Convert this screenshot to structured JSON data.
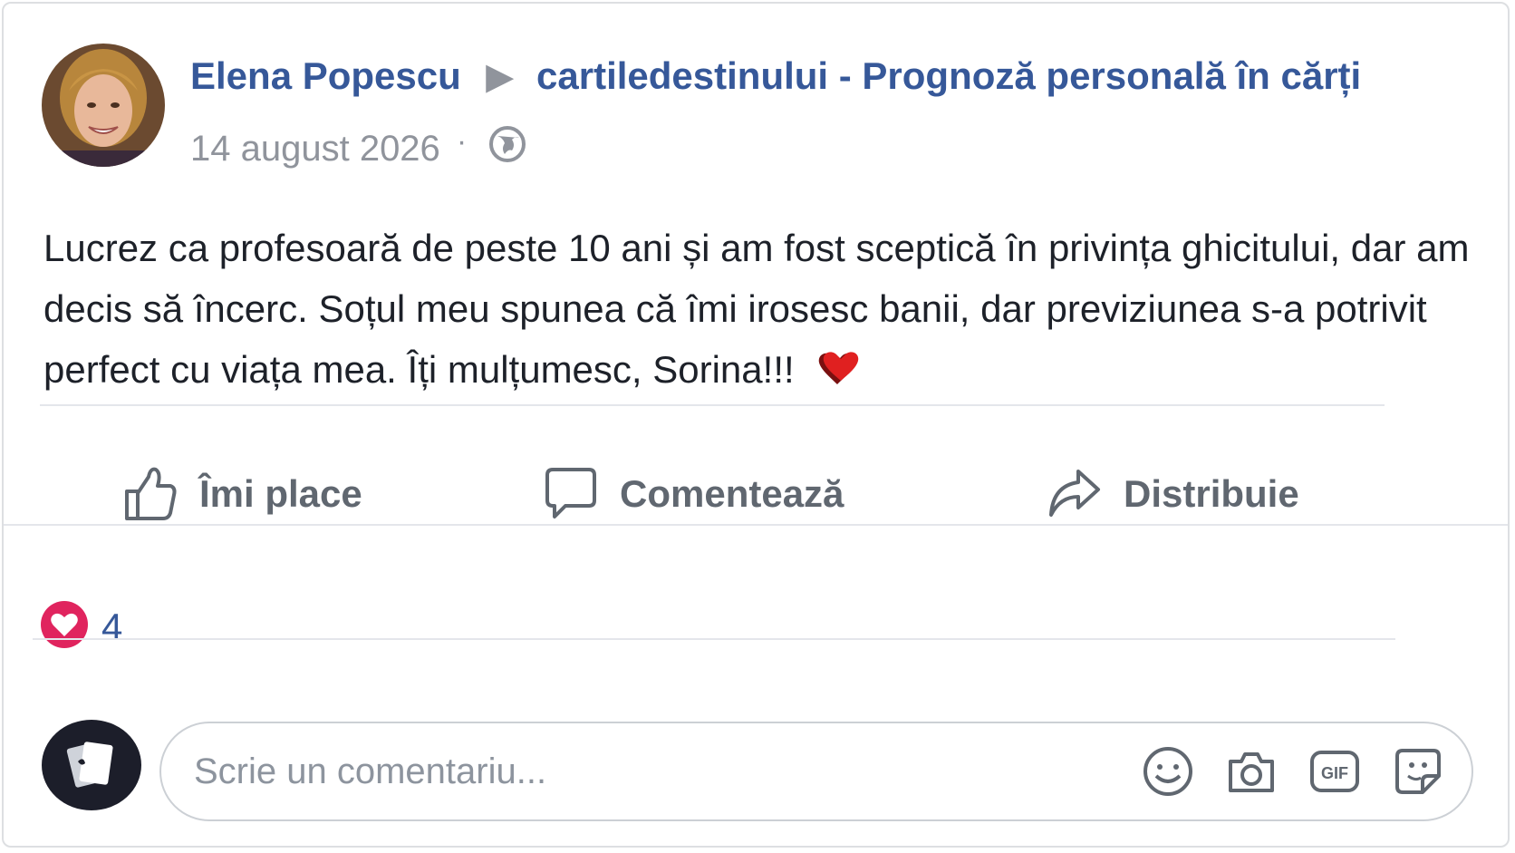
{
  "post": {
    "author": "Elena Popescu",
    "separator": "▶",
    "page": "cartiledestinului - Prognoză personală în cărți",
    "date": "14 august 2026",
    "dot": "·",
    "text": "Lucrez ca profesoară de peste 10 ani și am fost sceptică în privința ghicitului, dar am decis să încerc. Soțul meu spunea că îmi irosesc banii, dar previziunea s-a potrivit perfect cu viața mea. Îți mulțumesc, Sorina!!!"
  },
  "actions": {
    "like": "Îmi place",
    "comment": "Comentează",
    "share": "Distribuie"
  },
  "reactions": {
    "count": "4"
  },
  "comment": {
    "placeholder": "Scrie un comentariu..."
  },
  "colors": {
    "link": "#365899",
    "muted": "#90949c",
    "heart": "#e0245e"
  },
  "icons": [
    "globe-icon",
    "thumbs-up-icon",
    "comment-bubble-icon",
    "share-arrow-icon",
    "heart-reaction-icon",
    "emoji-icon",
    "camera-icon",
    "gif-icon",
    "sticker-icon"
  ]
}
